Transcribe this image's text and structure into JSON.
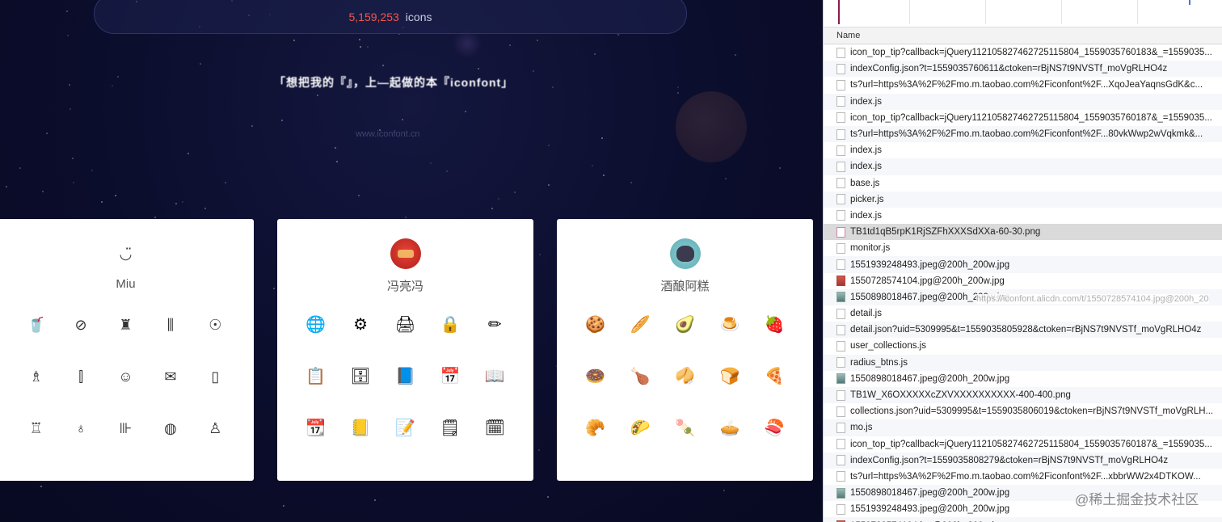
{
  "site": {
    "icon_count": "5,159,253",
    "icon_count_unit": "icons",
    "slogan": "「想把我的『』，上—起做的本『iconfont」",
    "url": "www.iconfont.cn"
  },
  "cards": [
    {
      "name": "Miu",
      "avatar": "smile-icon",
      "icons": [
        {
          "name": "cup-icon",
          "glyph": "🥤"
        },
        {
          "name": "makeup-compact-icon",
          "glyph": "⊘"
        },
        {
          "name": "lotion-bottle-icon",
          "glyph": "♜"
        },
        {
          "name": "cosmetics-icon",
          "glyph": "⫼"
        },
        {
          "name": "mirror-icon",
          "glyph": "☉"
        },
        {
          "name": "perfume-brush-icon",
          "glyph": "♗"
        },
        {
          "name": "brushes-icon",
          "glyph": "⫿"
        },
        {
          "name": "face-icon",
          "glyph": "☺"
        },
        {
          "name": "envelope-icon",
          "glyph": "✉"
        },
        {
          "name": "phone-icon",
          "glyph": "▯"
        },
        {
          "name": "bottle-icon",
          "glyph": "♖"
        },
        {
          "name": "nail-icon",
          "glyph": "♁"
        },
        {
          "name": "brush-set-icon",
          "glyph": "⊪"
        },
        {
          "name": "eyeshadow-icon",
          "glyph": "◍"
        },
        {
          "name": "perfume-icon",
          "glyph": "♙"
        }
      ]
    },
    {
      "name": "冯亮冯",
      "avatar": "red-avatar",
      "icons": [
        {
          "name": "globe-pencil-icon",
          "glyph": "🌐"
        },
        {
          "name": "gear-wrench-icon",
          "glyph": "⚙"
        },
        {
          "name": "printer-icon",
          "glyph": "🖨"
        },
        {
          "name": "lock-icon",
          "glyph": "🔒"
        },
        {
          "name": "pencil-ruler-icon",
          "glyph": "✏"
        },
        {
          "name": "clipboard-list-icon",
          "glyph": "📋"
        },
        {
          "name": "safe-icon",
          "glyph": "🗄"
        },
        {
          "name": "notebook-blue-icon",
          "glyph": "📘"
        },
        {
          "name": "calendar-25-icon",
          "glyph": "📅"
        },
        {
          "name": "open-book-icon",
          "glyph": "📖"
        },
        {
          "name": "calendar-5-icon",
          "glyph": "📆"
        },
        {
          "name": "address-book-icon",
          "glyph": "📒"
        },
        {
          "name": "checklist-icon",
          "glyph": "📝"
        },
        {
          "name": "notepad-pen-icon",
          "glyph": "🗒"
        },
        {
          "name": "calendar-17-icon",
          "glyph": "🗓"
        }
      ]
    },
    {
      "name": "酒酿阿糕",
      "avatar": "cat-avatar",
      "icons": [
        {
          "name": "cookie-icon",
          "glyph": "🍪"
        },
        {
          "name": "bread-roll-icon",
          "glyph": "🥖"
        },
        {
          "name": "avocado-icon",
          "glyph": "🥑"
        },
        {
          "name": "pudding-icon",
          "glyph": "🍮"
        },
        {
          "name": "strawberry-icon",
          "glyph": "🍓"
        },
        {
          "name": "donut-icon",
          "glyph": "🍩"
        },
        {
          "name": "chicken-leg-icon",
          "glyph": "🍗"
        },
        {
          "name": "cracker-icon",
          "glyph": "🥠"
        },
        {
          "name": "toast-icon",
          "glyph": "🍞"
        },
        {
          "name": "pizza-icon",
          "glyph": "🍕"
        },
        {
          "name": "baguette-icon",
          "glyph": "🥐"
        },
        {
          "name": "taco-icon",
          "glyph": "🌮"
        },
        {
          "name": "popsicle-icon",
          "glyph": "🍡"
        },
        {
          "name": "pie-icon",
          "glyph": "🥧"
        },
        {
          "name": "sushi-icon",
          "glyph": "🍣"
        }
      ]
    }
  ],
  "devtools": {
    "column_name": "Name",
    "rows": [
      {
        "name": "icon_top_tip?callback=jQuery11210582746272511​5804_1559035760183&_=1559035...",
        "type": "doc"
      },
      {
        "name": "indexConfig.json?t=1559035760611&ctoken=rBjNS7t9NVSTf_moVgRLHO4z",
        "type": "doc"
      },
      {
        "name": "ts?url=https%3A%2F%2Fmo.m.taobao.com%2Ficonfont%2F...XqoJeaYaqnsGdK&c...",
        "type": "doc"
      },
      {
        "name": "index.js",
        "type": "doc"
      },
      {
        "name": "icon_top_tip?callback=jQuery112105827462725115804_1559035760187&_=1559035...",
        "type": "doc"
      },
      {
        "name": "ts?url=https%3A%2F%2Fmo.m.taobao.com%2Ficonfont%2F...80vkWwp2wVqkmk&...",
        "type": "doc"
      },
      {
        "name": "index.js",
        "type": "doc"
      },
      {
        "name": "index.js",
        "type": "doc"
      },
      {
        "name": "base.js",
        "type": "doc"
      },
      {
        "name": "picker.js",
        "type": "doc"
      },
      {
        "name": "index.js",
        "type": "doc"
      },
      {
        "name": "TB1td1qB5rpK1RjSZFhXXXSdXXa-60-30.png",
        "type": "png",
        "selected": true
      },
      {
        "name": "monitor.js",
        "type": "doc"
      },
      {
        "name": "1551939248493.jpeg@200h_200w.jpg",
        "type": "doc"
      },
      {
        "name": "1550728574104.jpg@200h_200w.jpg",
        "type": "photo"
      },
      {
        "name": "1550898018467.jpeg@200h_200w.jpg",
        "type": "img"
      },
      {
        "name": "detail.js",
        "type": "doc"
      },
      {
        "name": "detail.json?uid=5309995&t=1559035805928&ctoken=rBjNS7t9NVSTf_moVgRLHO4z",
        "type": "doc"
      },
      {
        "name": "user_collections.js",
        "type": "doc"
      },
      {
        "name": "radius_btns.js",
        "type": "doc"
      },
      {
        "name": "1550898018467.jpeg@200h_200w.jpg",
        "type": "img"
      },
      {
        "name": "TB1W_X6OXXXXXcZXVXXXXXXXXXX-400-400.png",
        "type": "doc"
      },
      {
        "name": "collections.json?uid=5309995&t=1559035806019&ctoken=rBjNS7t9NVSTf_moVgRLH...",
        "type": "doc"
      },
      {
        "name": "mo.js",
        "type": "doc"
      },
      {
        "name": "icon_top_tip?callback=jQuery112105827462725115804_1559035760187&_=1559035...",
        "type": "doc"
      },
      {
        "name": "indexConfig.json?t=1559035808279&ctoken=rBjNS7t9NVSTf_moVgRLHO4z",
        "type": "doc"
      },
      {
        "name": "ts?url=https%3A%2F%2Fmo.m.taobao.com%2Ficonfont%2F...xbbrWW2x4DTKOW...",
        "type": "doc"
      },
      {
        "name": "1550898018467.jpeg@200h_200w.jpg",
        "type": "img"
      },
      {
        "name": "1551939248493.jpeg@200h_200w.jpg",
        "type": "doc"
      },
      {
        "name": "1550728574104.jpg@200h_200w.jpg",
        "type": "photo"
      }
    ],
    "tooltip": "https://iconfont.alicdn.com/t/1550728574104.jpg@200h_20"
  },
  "watermark": "@稀土掘金技术社区",
  "colors": {
    "count_red": "#f3564b",
    "space_bg": "#0b0d2c",
    "selected_row": "#dadada"
  }
}
